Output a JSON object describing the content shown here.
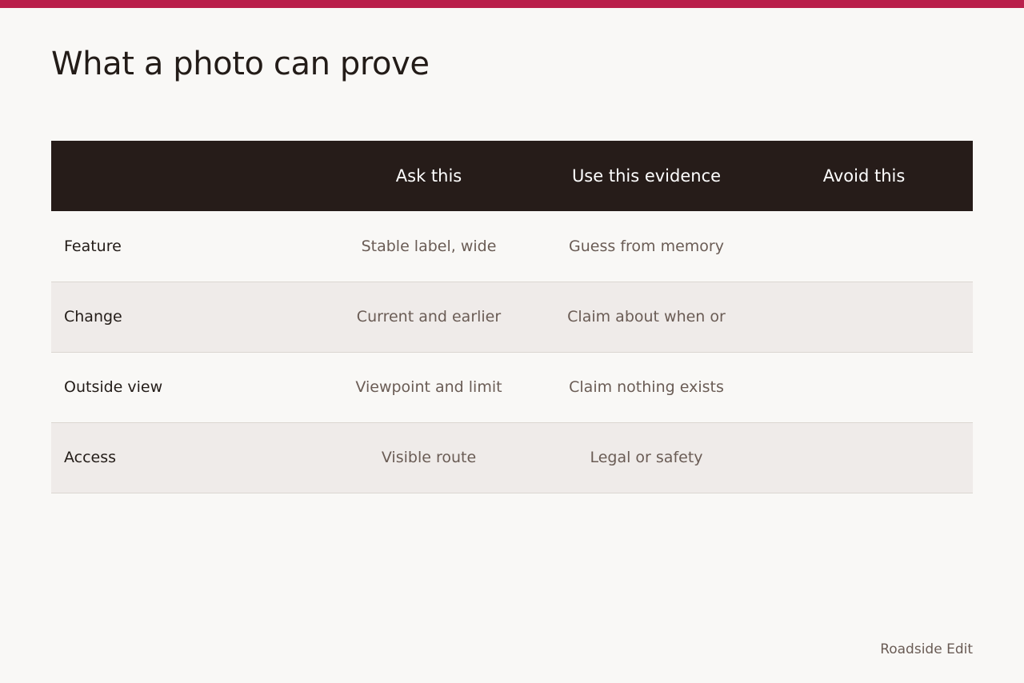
{
  "page": {
    "title": "What a photo can prove",
    "accent_color": "#b91f4b",
    "header_color": "#261c19",
    "footer_brand": "Roadside Edit"
  },
  "table": {
    "columns": [
      "",
      "Ask this",
      "Use this evidence",
      "Avoid this"
    ],
    "rows": [
      {
        "label": "Feature",
        "ask": "Stable label, wide",
        "evidence": "Guess from memory",
        "avoid": ""
      },
      {
        "label": "Change",
        "ask": "Current and earlier",
        "evidence": "Claim about when or",
        "avoid": ""
      },
      {
        "label": "Outside view",
        "ask": "Viewpoint and limit",
        "evidence": "Claim nothing exists",
        "avoid": ""
      },
      {
        "label": "Access",
        "ask": "Visible route",
        "evidence": "Legal or safety",
        "avoid": ""
      }
    ]
  }
}
